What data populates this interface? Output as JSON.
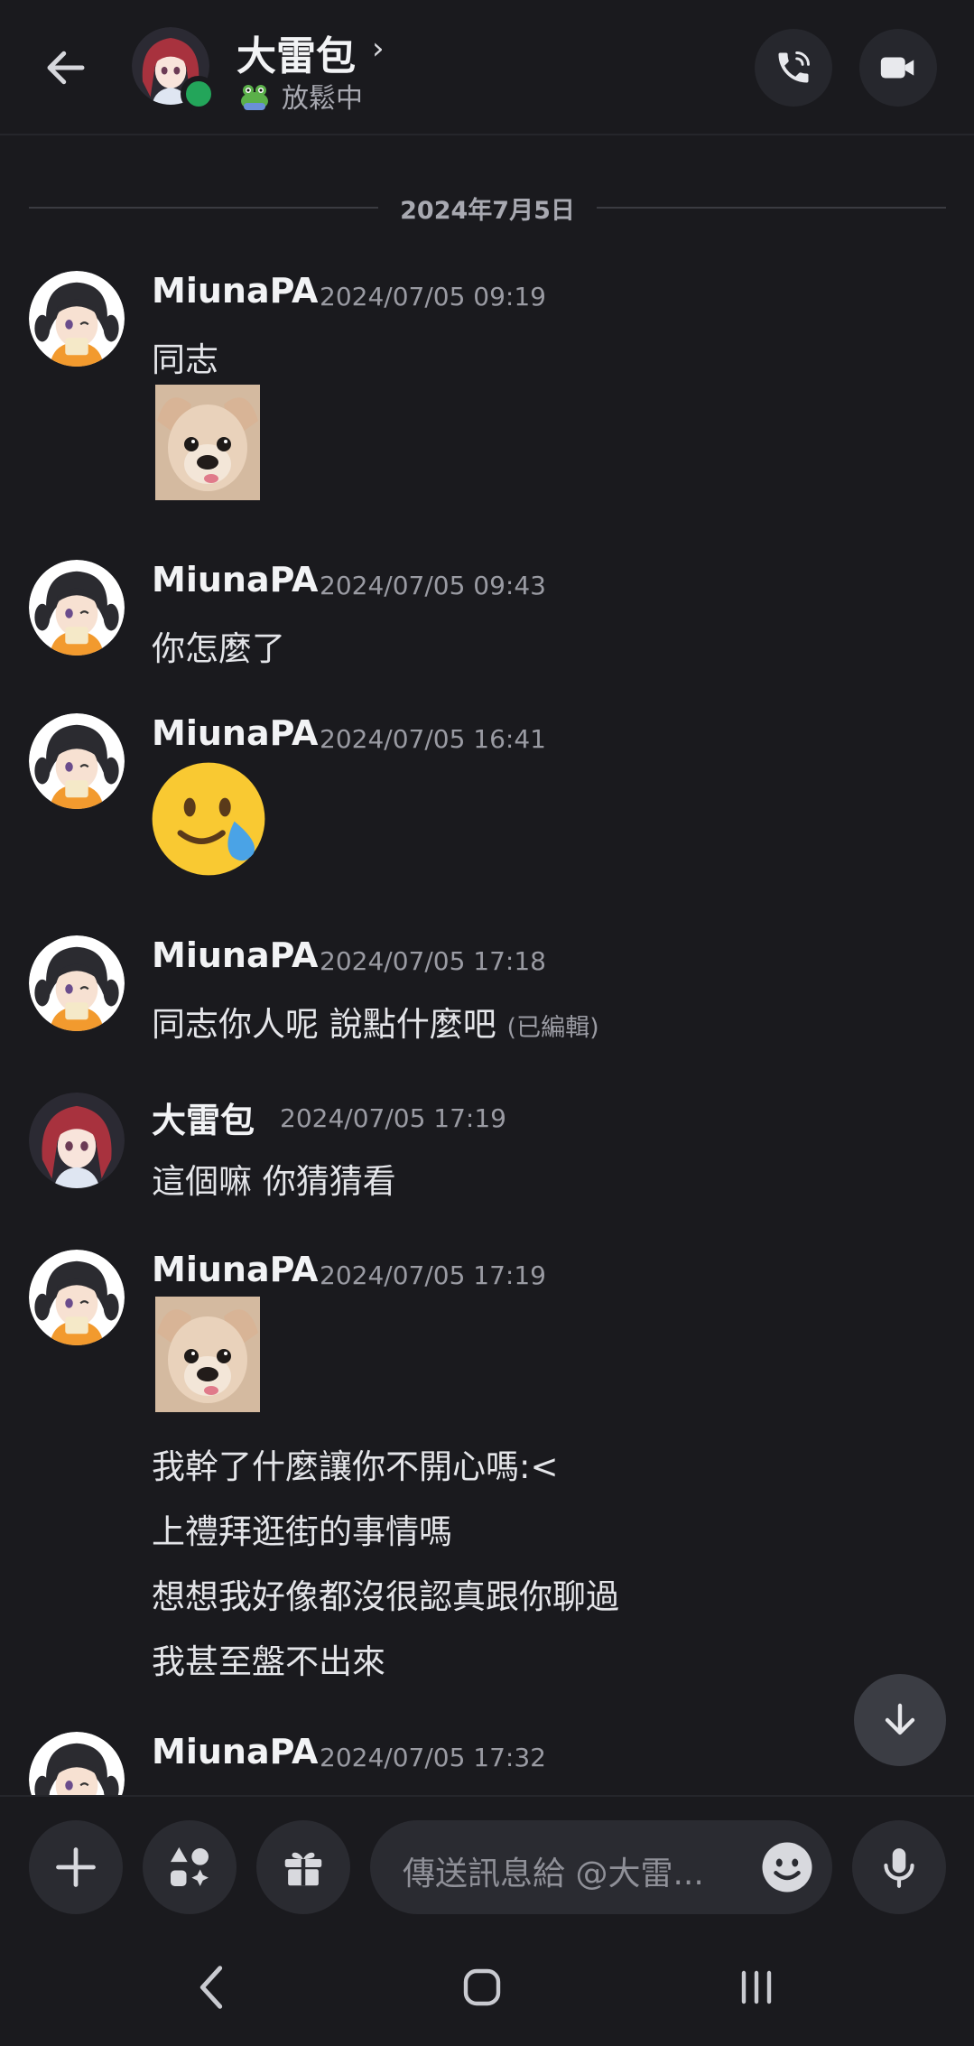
{
  "header": {
    "title": "大雷包",
    "status": "放鬆中",
    "online": true
  },
  "date_divider": "2024年7月5日",
  "messages": [
    {
      "author": "MiunaPA",
      "time": "2024/07/05 09:19",
      "text": "同志",
      "attachment": "chihuahua-sticker"
    },
    {
      "author": "MiunaPA",
      "time": "2024/07/05 09:43",
      "text": "你怎麼了"
    },
    {
      "author": "MiunaPA",
      "time": "2024/07/05 16:41",
      "emoji": "smiling-face-with-tear"
    },
    {
      "author": "MiunaPA",
      "time": "2024/07/05 17:18",
      "text": "同志你人呢 說點什麼吧",
      "edited": "(已編輯)"
    },
    {
      "author": "大雷包",
      "time": "2024/07/05 17:19",
      "text": "這個嘛 你猜猜看"
    },
    {
      "author": "MiunaPA",
      "time": "2024/07/05 17:19",
      "attachment": "chihuahua-sticker",
      "lines": [
        "我幹了什麼讓你不開心嗎:<",
        "上禮拜逛街的事情嗎",
        "想想我好像都沒很認真跟你聊過",
        "我甚至盤不出來"
      ]
    },
    {
      "author": "MiunaPA",
      "time": "2024/07/05 17:32"
    }
  ],
  "composer": {
    "placeholder": "傳送訊息給 @大雷..."
  },
  "icons": {
    "back": "arrow-left-icon",
    "call": "phone-icon",
    "video": "video-camera-icon",
    "plus": "plus-icon",
    "apps": "apps-icon",
    "gift": "gift-icon",
    "emoji": "emoji-icon",
    "mic": "microphone-icon",
    "scroll": "arrow-down-icon"
  },
  "colors": {
    "background": "#1a1a1e",
    "online": "#23a55a"
  }
}
